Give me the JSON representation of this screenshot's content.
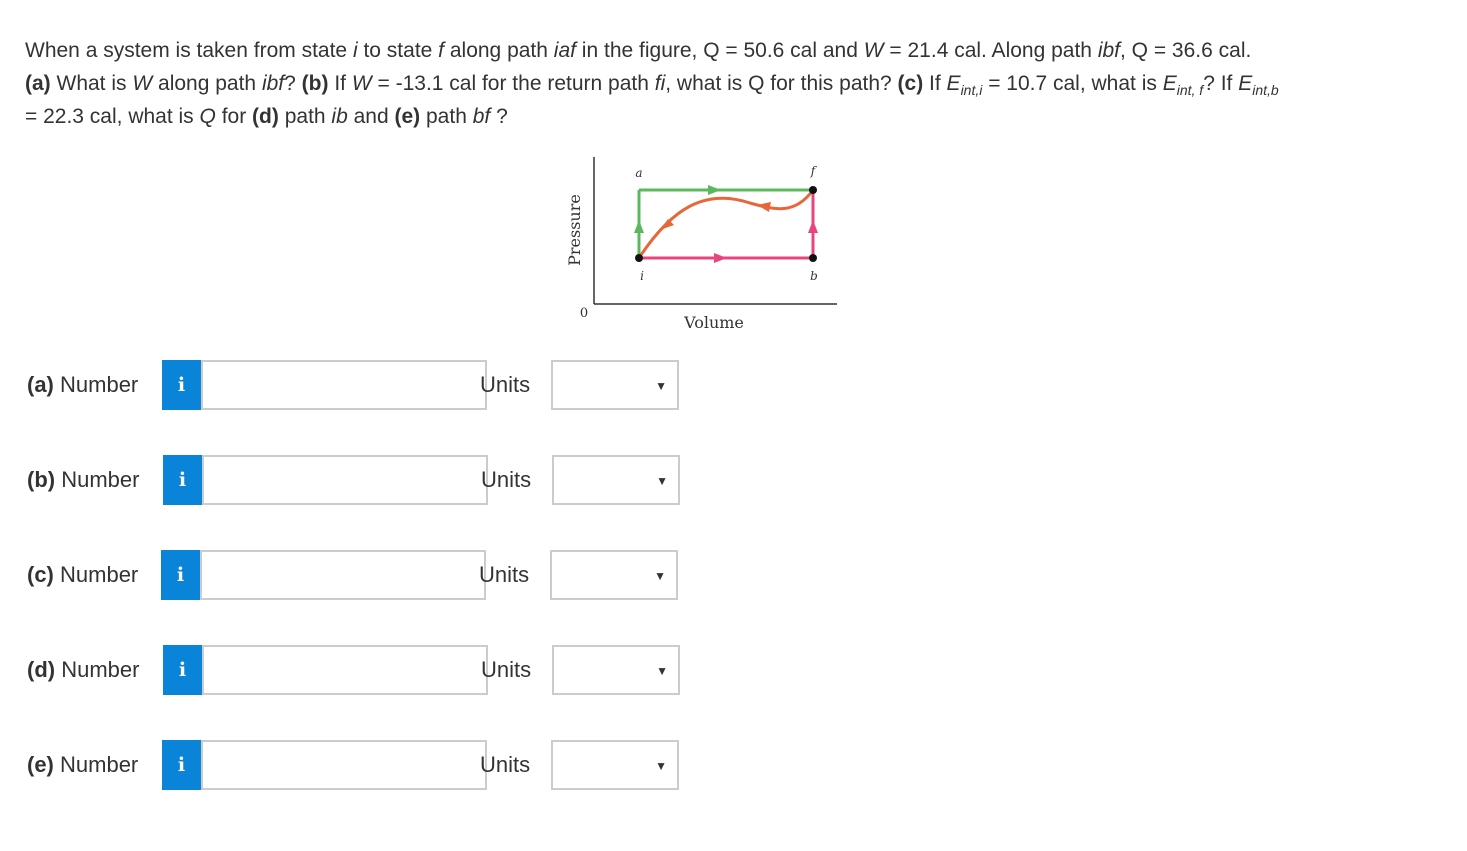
{
  "question": {
    "t1": "When a system is taken from state ",
    "i": "i",
    "t2": " to state ",
    "f": "f",
    "t3": " along path ",
    "iaf": "iaf",
    "t4": " in the figure, Q = 50.6 cal and ",
    "W": "W",
    "t5": " = 21.4 cal. Along path ",
    "ibf": "ibf",
    "t6": ", Q = 36.6 cal.",
    "pa": "(a)",
    "t7": " What is ",
    "W2": "W",
    "t8": " along path ",
    "ibf2": "ibf",
    "t9": "? ",
    "pb": "(b)",
    "t10": " If ",
    "W3": "W",
    "t11": " = -13.1 cal for the return path ",
    "fi": "fi",
    "t12": ", what is Q for this path? ",
    "pc": "(c)",
    "t13": " If ",
    "E1": "E",
    "E1sub": "int,i",
    "t14": " = 10.7 cal, what is ",
    "E2": "E",
    "E2sub": "int, f",
    "t15": "? If ",
    "E3": "E",
    "E3sub": "int,b",
    "t16": "= 22.3 cal, what is ",
    "Q": "Q",
    "t17": " for ",
    "pd": "(d)",
    "t18": " path ",
    "ib": "ib",
    "t19": " and ",
    "pe": "(e)",
    "t20": " path ",
    "bf": "bf",
    "t21": " ?"
  },
  "figure": {
    "ylabel": "Pressure",
    "xlabel": "Volume",
    "origin": "0",
    "point_a": "a",
    "point_f": "f",
    "point_i": "i",
    "point_b": "b",
    "colors": {
      "green": "#5cb85c",
      "orange": "#e8673a",
      "pink": "#e8447e",
      "axis": "#333333"
    }
  },
  "rows": [
    {
      "part": "(a)",
      "label": "Number",
      "info": "i",
      "value": "",
      "units_label": "Units",
      "units_value": ""
    },
    {
      "part": "(b)",
      "label": "Number",
      "info": "i",
      "value": "",
      "units_label": "Units",
      "units_value": ""
    },
    {
      "part": "(c)",
      "label": "Number",
      "info": "i",
      "value": "",
      "units_label": "Units",
      "units_value": ""
    },
    {
      "part": "(d)",
      "label": "Number",
      "info": "i",
      "value": "",
      "units_label": "Units",
      "units_value": ""
    },
    {
      "part": "(e)",
      "label": "Number",
      "info": "i",
      "value": "",
      "units_label": "Units",
      "units_value": ""
    }
  ],
  "accent_color": "#0a84d8"
}
